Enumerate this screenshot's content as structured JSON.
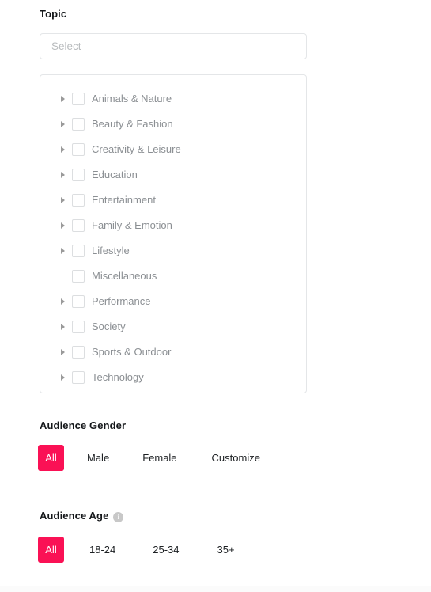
{
  "topic": {
    "label": "Topic",
    "select": {
      "placeholder": "Select",
      "value": ""
    },
    "items": [
      {
        "label": "Animals & Nature",
        "expandable": true,
        "checked": false
      },
      {
        "label": "Beauty & Fashion",
        "expandable": true,
        "checked": false
      },
      {
        "label": "Creativity & Leisure",
        "expandable": true,
        "checked": false
      },
      {
        "label": "Education",
        "expandable": true,
        "checked": false
      },
      {
        "label": "Entertainment",
        "expandable": true,
        "checked": false
      },
      {
        "label": "Family & Emotion",
        "expandable": true,
        "checked": false
      },
      {
        "label": "Lifestyle",
        "expandable": true,
        "checked": false
      },
      {
        "label": "Miscellaneous",
        "expandable": false,
        "checked": false
      },
      {
        "label": "Performance",
        "expandable": true,
        "checked": false
      },
      {
        "label": "Society",
        "expandable": true,
        "checked": false
      },
      {
        "label": "Sports & Outdoor",
        "expandable": true,
        "checked": false
      },
      {
        "label": "Technology",
        "expandable": true,
        "checked": false
      }
    ]
  },
  "audience_gender": {
    "label": "Audience Gender",
    "options": [
      "All",
      "Male",
      "Female",
      "Customize"
    ],
    "selected": "All"
  },
  "audience_age": {
    "label": "Audience Age",
    "info_icon": "info-icon",
    "options": [
      "All",
      "18-24",
      "25-34",
      "35+"
    ],
    "selected": "All"
  },
  "colors": {
    "accent": "#fa1155",
    "border": "#e4e6e8",
    "item_text": "#8b8f93",
    "heading": "#14171a",
    "placeholder": "#b9bcbe"
  }
}
